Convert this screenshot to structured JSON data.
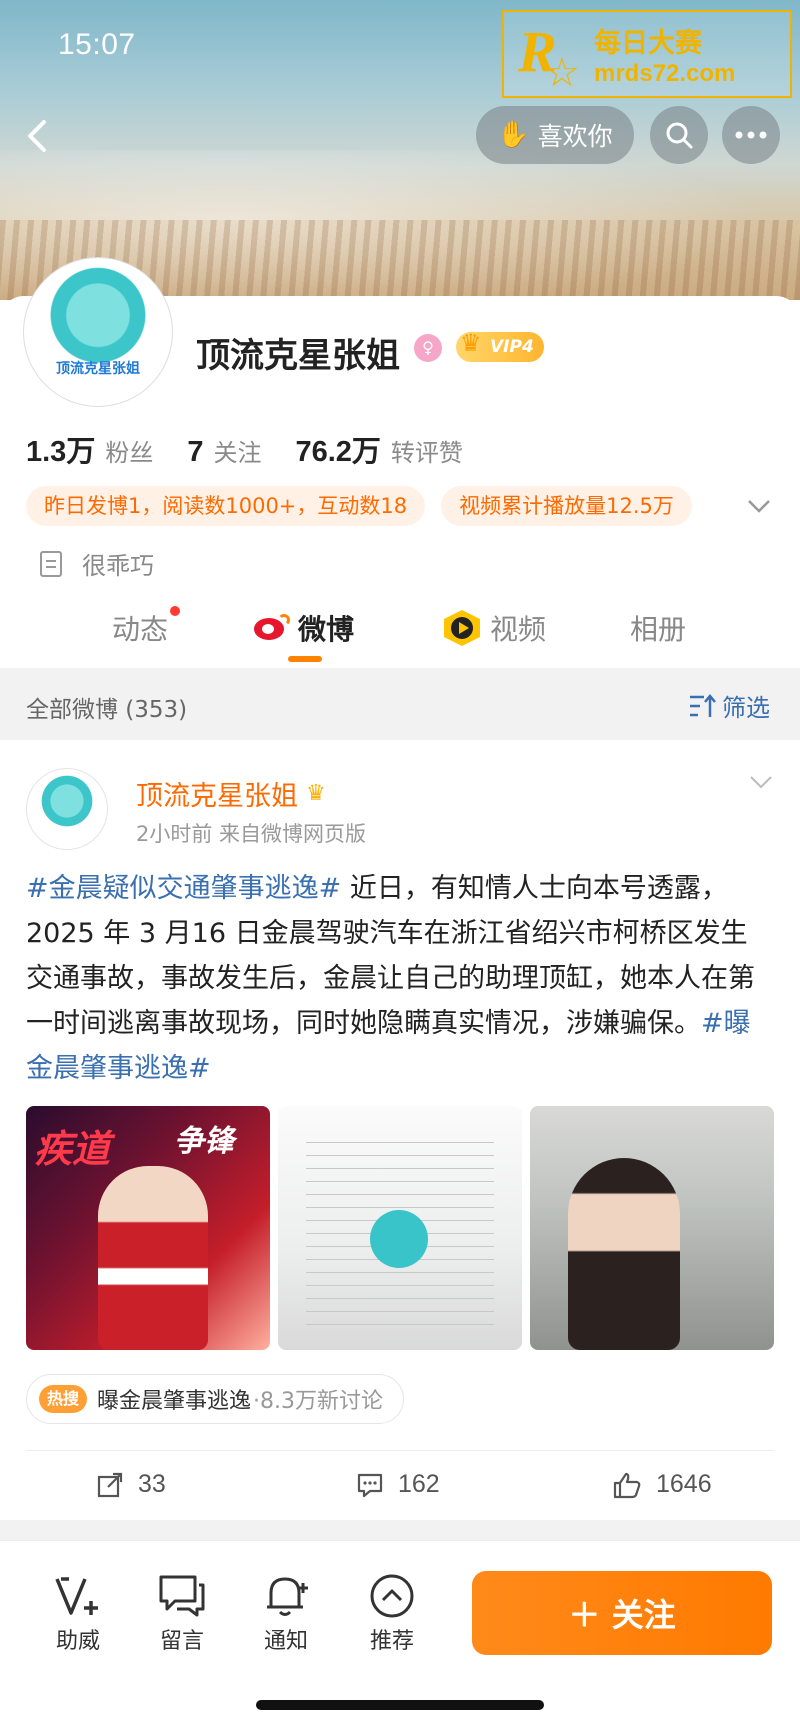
{
  "status_bar": {
    "time": "15:07"
  },
  "watermark": {
    "logo_letter": "R",
    "cn": "每日大赛",
    "url": "mrds72.com"
  },
  "header": {
    "back_icon": "chevron-left-icon",
    "like_label": "喜欢你",
    "search_icon": "search-icon",
    "more_icon": "more-icon"
  },
  "profile": {
    "avatar_caption": "顶流克星张姐",
    "name": "顶流克星张姐",
    "vip_label": "VIP4",
    "stats": [
      {
        "num": "1.3万",
        "label": "粉丝"
      },
      {
        "num": "7",
        "label": "关注"
      },
      {
        "num": "76.2万",
        "label": "转评赞"
      }
    ],
    "chips": [
      "昨日发博1，阅读数1000+，互动数18",
      "视频累计播放量12.5万"
    ],
    "bio": "很乖巧"
  },
  "tabs": [
    {
      "label": "动态"
    },
    {
      "label": "微博"
    },
    {
      "label": "视频"
    },
    {
      "label": "相册"
    }
  ],
  "filter": {
    "title": "全部微博 (353)",
    "button": "筛选"
  },
  "post": {
    "author": "顶流克星张姐",
    "meta": "2小时前  来自微博网页版",
    "topic1": "#金晨疑似交通肇事逃逸#",
    "body": " 近日，有知情人士向本号透露，2025 年 3 月16 日金晨驾驶汽车在浙江省绍兴市柯桥区发生交通事故，事故发生后，金晨让自己的助理顶缸，她本人在第一时间逃离事故现场，同时她隐瞒真实情况，涉嫌骗保。",
    "topic2": "#曝金晨肇事逃逸#",
    "image1_title_a": "疾道",
    "image1_title_b": "争锋",
    "hot_badge": "热搜",
    "hot_title": "曝金晨肇事逃逸",
    "hot_sub": "·8.3万新讨论",
    "reposts": "33",
    "comments": "162",
    "likes": "1646"
  },
  "bottom_bar": {
    "items": [
      {
        "label": "助威",
        "icon": "v-plus-icon"
      },
      {
        "label": "留言",
        "icon": "message-icon"
      },
      {
        "label": "通知",
        "icon": "bell-icon"
      },
      {
        "label": "推荐",
        "icon": "up-arrow-circle-icon"
      }
    ],
    "follow_label": "＋ 关注"
  }
}
